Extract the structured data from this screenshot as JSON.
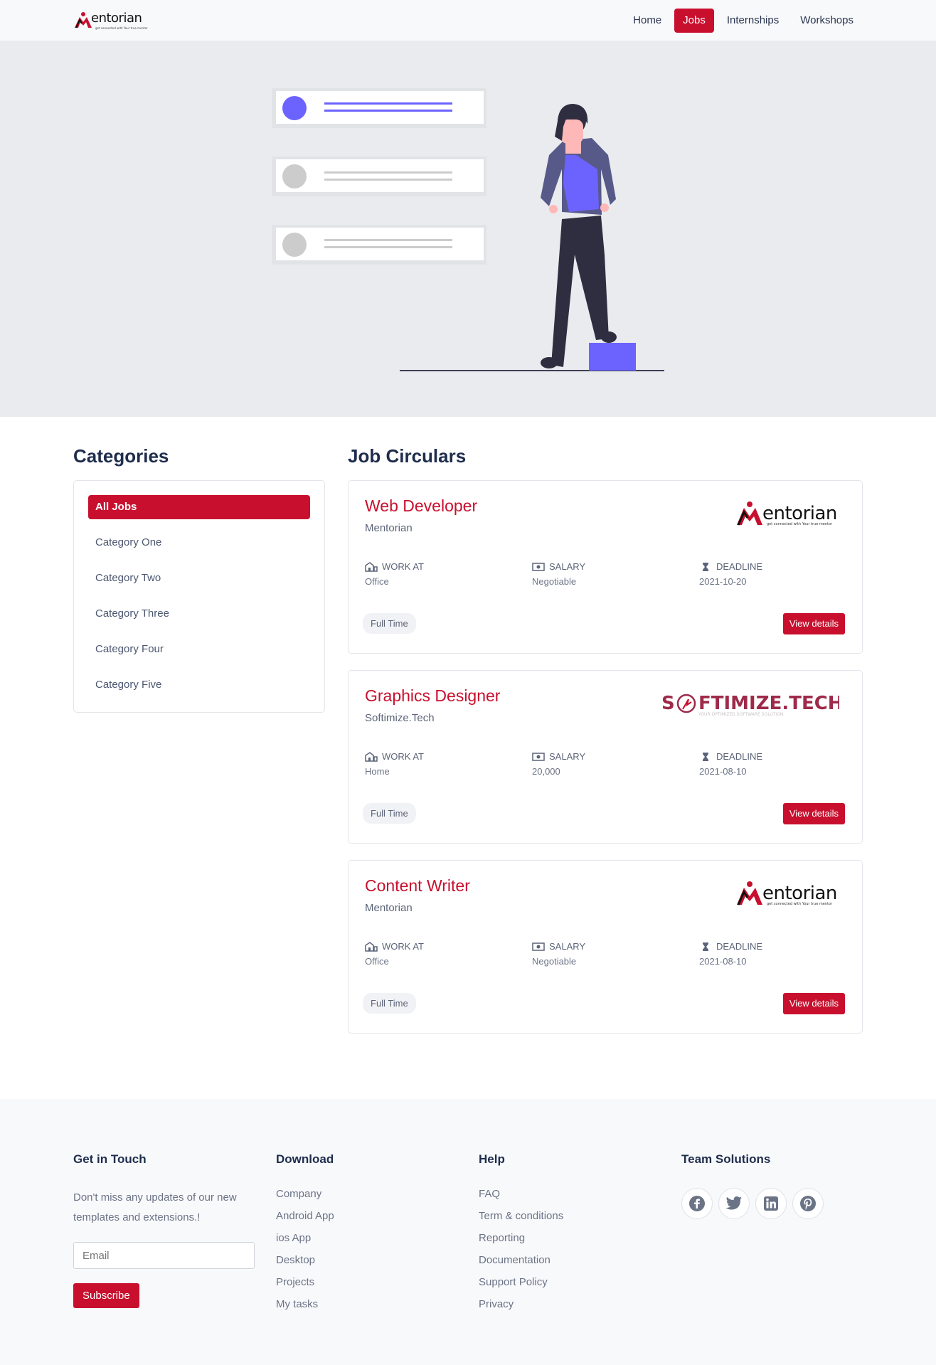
{
  "brand": {
    "name": "entorian",
    "tagline": "get connected with Your true mentor"
  },
  "nav": {
    "items": [
      "Home",
      "Jobs",
      "Internships",
      "Workshops"
    ],
    "active": "Jobs"
  },
  "sidebar": {
    "heading": "Categories",
    "items": [
      {
        "label": "All Jobs",
        "active": true
      },
      {
        "label": "Category One"
      },
      {
        "label": "Category Two"
      },
      {
        "label": "Category Three"
      },
      {
        "label": "Category Four"
      },
      {
        "label": "Category Five"
      }
    ]
  },
  "main": {
    "heading": "Job Circulars",
    "meta_labels": {
      "work_at": "WORK AT",
      "salary": "SALARY",
      "deadline": "DEADLINE"
    },
    "view_label": "View details",
    "jobs": [
      {
        "title": "Web Developer",
        "company": "Mentorian",
        "logo": "mentorian-logo",
        "work_at": "Office",
        "salary": "Negotiable",
        "deadline": "2021-10-20",
        "type": "Full Time"
      },
      {
        "title": "Graphics Designer",
        "company": "Softimize.Tech",
        "logo": "softimize-logo",
        "work_at": "Home",
        "salary": "20,000",
        "deadline": "2021-08-10",
        "type": "Full Time"
      },
      {
        "title": "Content Writer",
        "company": "Mentorian",
        "logo": "mentorian-logo",
        "work_at": "Office",
        "salary": "Negotiable",
        "deadline": "2021-08-10",
        "type": "Full Time"
      }
    ]
  },
  "softimize_logo": {
    "text": "S FTIMIZE.TECH",
    "tagline": "YOUR OPTIMIZED SOFTWARE SOLUTION"
  },
  "footer": {
    "touch": {
      "heading": "Get in Touch",
      "text": "Don't miss any updates of our new templates and extensions.!",
      "email_placeholder": "Email",
      "subscribe": "Subscribe"
    },
    "download": {
      "heading": "Download",
      "links": [
        "Company",
        "Android App",
        "ios App",
        "Desktop",
        "Projects",
        "My tasks"
      ]
    },
    "help": {
      "heading": "Help",
      "links": [
        "FAQ",
        "Term & conditions",
        "Reporting",
        "Documentation",
        "Support Policy",
        "Privacy"
      ]
    },
    "team": {
      "heading": "Team Solutions",
      "social": [
        "facebook-icon",
        "twitter-icon",
        "linkedin-icon",
        "pinterest-icon"
      ]
    }
  },
  "colors": {
    "accent": "#c8102e",
    "purple": "#6c63ff",
    "text": "#1f2d4d"
  }
}
